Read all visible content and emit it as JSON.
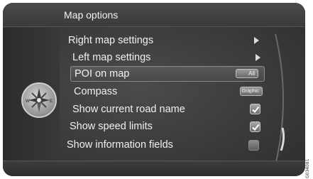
{
  "header": {
    "title": "Map options"
  },
  "menu": {
    "items": [
      {
        "label": "Right map settings",
        "control": "arrow"
      },
      {
        "label": "Left map settings",
        "control": "arrow"
      },
      {
        "label": "POI on map",
        "control": "pill",
        "value": "All",
        "selected": true
      },
      {
        "label": "Compass",
        "control": "pill",
        "value": "Graphic"
      },
      {
        "label": "Show current road name",
        "control": "checkbox",
        "checked": true
      },
      {
        "label": "Show speed limits",
        "control": "checkbox",
        "checked": true
      },
      {
        "label": "Show information fields",
        "control": "checkbox",
        "checked": false
      }
    ]
  },
  "compass": {
    "west": "W",
    "east": "E",
    "icon": "compass-icon"
  },
  "image_code": "G034081",
  "colors": {
    "screen_bg": "#3a3a3a",
    "text": "#f0f0f0",
    "selection_border": "#8a8a8a"
  }
}
